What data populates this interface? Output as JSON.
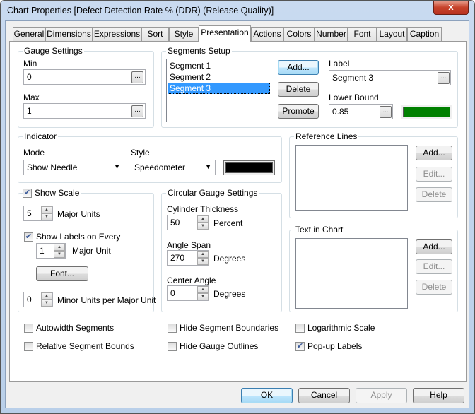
{
  "window": {
    "title": "Chart Properties [Defect Detection Rate % (DDR) (Release Quality)]",
    "close": "x"
  },
  "tabs": [
    "General",
    "Dimensions",
    "Expressions",
    "Sort",
    "Style",
    "Presentation",
    "Actions",
    "Colors",
    "Number",
    "Font",
    "Layout",
    "Caption"
  ],
  "active_tab": "Presentation",
  "gauge_settings": {
    "title": "Gauge Settings",
    "min_label": "Min",
    "min_value": "0",
    "max_label": "Max",
    "max_value": "1",
    "dots": "..."
  },
  "segments": {
    "title": "Segments Setup",
    "items": [
      "Segment 1",
      "Segment 2",
      "Segment 3"
    ],
    "selected": "Segment 3",
    "add": "Add...",
    "delete": "Delete",
    "promote": "Promote",
    "label_label": "Label",
    "label_value": "Segment 3",
    "lower_bound_label": "Lower Bound",
    "lower_bound_value": "0.85",
    "segment_color": "#008000"
  },
  "indicator": {
    "title": "Indicator",
    "mode_label": "Mode",
    "mode_value": "Show Needle",
    "style_label": "Style",
    "style_value": "Speedometer",
    "color": "#000000"
  },
  "reference_lines": {
    "title": "Reference Lines",
    "add": "Add...",
    "edit": "Edit...",
    "delete": "Delete"
  },
  "text_in_chart": {
    "title": "Text in Chart",
    "add": "Add...",
    "edit": "Edit...",
    "delete": "Delete"
  },
  "scale": {
    "show_scale": "Show Scale",
    "show_scale_checked": true,
    "major_units_value": "5",
    "major_units_label": "Major Units",
    "show_labels": "Show Labels on Every",
    "show_labels_checked": true,
    "label_every_value": "1",
    "major_unit_label": "Major Unit",
    "font": "Font...",
    "minor_value": "0",
    "minor_label": "Minor Units per Major Unit"
  },
  "circular": {
    "title": "Circular Gauge Settings",
    "cylinder_label": "Cylinder Thickness",
    "cylinder_value": "50",
    "percent": "Percent",
    "angle_span_label": "Angle Span",
    "angle_span_value": "270",
    "degrees": "Degrees",
    "center_angle_label": "Center Angle",
    "center_angle_value": "0"
  },
  "options": [
    {
      "label": "Autowidth Segments",
      "checked": false
    },
    {
      "label": "Relative Segment Bounds",
      "checked": false
    },
    {
      "label": "Hide Segment Boundaries",
      "checked": false
    },
    {
      "label": "Hide Gauge Outlines",
      "checked": false
    },
    {
      "label": "Logarithmic Scale",
      "checked": false
    },
    {
      "label": "Pop-up Labels",
      "checked": true
    }
  ],
  "footer": {
    "ok": "OK",
    "cancel": "Cancel",
    "apply": "Apply",
    "help": "Help"
  }
}
